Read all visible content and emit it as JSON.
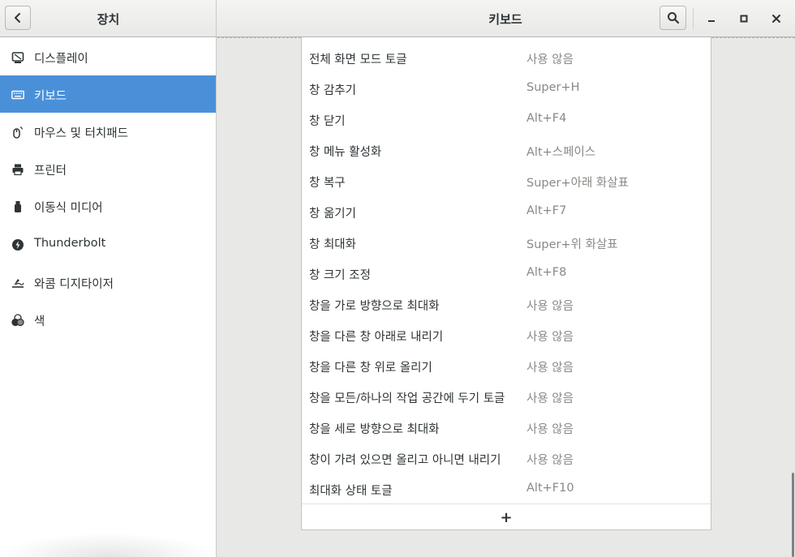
{
  "window": {
    "sidebar_title": "장치",
    "panel_title": "키보드"
  },
  "icons": {
    "back": "chevron-left-icon",
    "search": "search-icon",
    "minimize": "minimize-icon",
    "maximize": "maximize-icon",
    "close": "close-icon"
  },
  "colors": {
    "accent": "#4a90d9",
    "secondary_text": "#888a85"
  },
  "sidebar": {
    "items": [
      {
        "label": "디스플레이",
        "icon": "display-icon"
      },
      {
        "label": "키보드",
        "icon": "keyboard-icon",
        "selected": true
      },
      {
        "label": "마우스 및 터치패드",
        "icon": "mouse-icon"
      },
      {
        "label": "프린터",
        "icon": "printer-icon"
      },
      {
        "label": "이동식 미디어",
        "icon": "removable-media-icon"
      },
      {
        "label": "Thunderbolt",
        "icon": "thunderbolt-icon"
      },
      {
        "label": "와콤 디지타이저",
        "icon": "wacom-tablet-icon"
      },
      {
        "label": "색",
        "icon": "color-icon"
      }
    ]
  },
  "shortcuts": [
    {
      "name": "전체 화면 모드 토글",
      "key": "사용 않음"
    },
    {
      "name": "창 감추기",
      "key": "Super+H"
    },
    {
      "name": "창 닫기",
      "key": "Alt+F4"
    },
    {
      "name": "창 메뉴 활성화",
      "key": "Alt+스페이스"
    },
    {
      "name": "창 복구",
      "key": "Super+아래 화살표"
    },
    {
      "name": "창 옮기기",
      "key": "Alt+F7"
    },
    {
      "name": "창 최대화",
      "key": "Super+위 화살표"
    },
    {
      "name": "창 크기 조정",
      "key": "Alt+F8"
    },
    {
      "name": "창을 가로 방향으로 최대화",
      "key": "사용 않음"
    },
    {
      "name": "창을 다른 창 아래로 내리기",
      "key": "사용 않음"
    },
    {
      "name": "창을 다른 창 위로 올리기",
      "key": "사용 않음"
    },
    {
      "name": "창을 모든/하나의 작업 공간에 두기 토글",
      "key": "사용 않음"
    },
    {
      "name": "창을 세로 방향으로 최대화",
      "key": "사용 않음"
    },
    {
      "name": "창이 가려 있으면 올리고 아니면 내리기",
      "key": "사용 않음"
    },
    {
      "name": "최대화 상태 토글",
      "key": "Alt+F10"
    }
  ],
  "add_button": {
    "label": "+"
  }
}
